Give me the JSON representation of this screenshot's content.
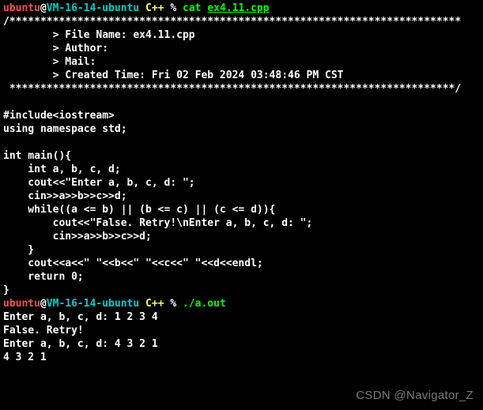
{
  "prompt1": {
    "user": "ubuntu",
    "at": "@",
    "host": "VM-16-14-ubuntu",
    "path": " C++ ",
    "pct": "% ",
    "cmd": "cat ",
    "arg": "ex4.11.cpp"
  },
  "hdr": {
    "top": "/*************************************************************************",
    "file": "        > File Name: ex4.11.cpp",
    "auth": "        > Author:",
    "mail": "        > Mail:",
    "time": "        > Created Time: Fri 02 Feb 2024 03:48:46 PM CST",
    "bot": " ************************************************************************/"
  },
  "code": {
    "blank1": "",
    "l1": "#include<iostream>",
    "l2": "using namespace std;",
    "blank2": "",
    "l3": "int main(){",
    "l4": "    int a, b, c, d;",
    "l5": "    cout<<\"Enter a, b, c, d: \";",
    "l6": "    cin>>a>>b>>c>>d;",
    "l7": "    while((a <= b) || (b <= c) || (c <= d)){",
    "l8": "        cout<<\"False. Retry!\\nEnter a, b, c, d: \";",
    "l9": "        cin>>a>>b>>c>>d;",
    "l10": "    }",
    "l11": "    cout<<a<<\" \"<<b<<\" \"<<c<<\" \"<<d<<endl;",
    "l12": "    return 0;",
    "l13": "}"
  },
  "prompt2": {
    "user": "ubuntu",
    "at": "@",
    "host": "VM-16-14-ubuntu",
    "path": " C++ ",
    "pct": "% ",
    "cmd": "./a.out"
  },
  "run": {
    "l1": "Enter a, b, c, d: 1 2 3 4",
    "l2": "False. Retry!",
    "l3": "Enter a, b, c, d: 4 3 2 1",
    "l4": "4 3 2 1"
  },
  "watermark": "CSDN @Navigator_Z"
}
